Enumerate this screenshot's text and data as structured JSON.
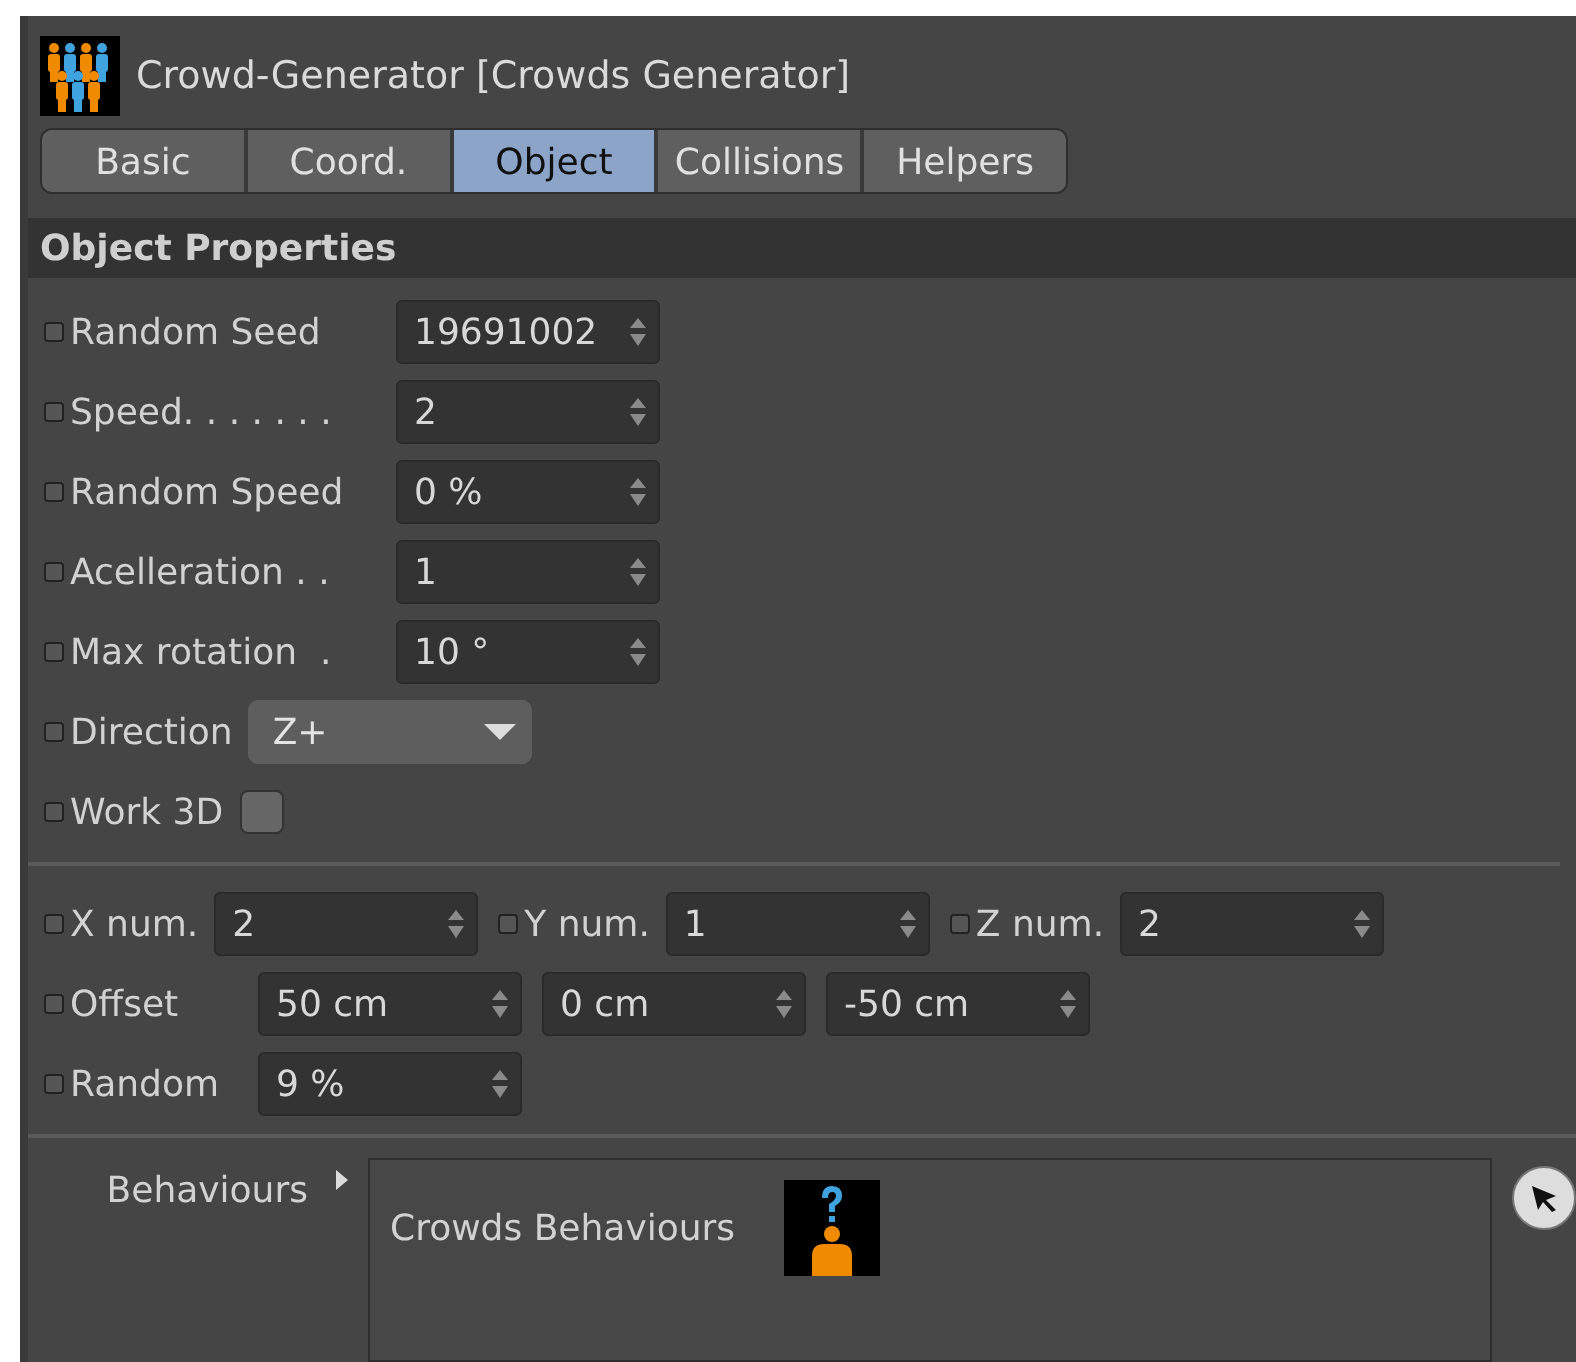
{
  "window": {
    "title": "Crowd-Generator [Crowds Generator]"
  },
  "tabs": [
    {
      "label": "Basic",
      "selected": false
    },
    {
      "label": "Coord.",
      "selected": false
    },
    {
      "label": "Object",
      "selected": true
    },
    {
      "label": "Collisions",
      "selected": false
    },
    {
      "label": "Helpers",
      "selected": false
    }
  ],
  "section": {
    "title": "Object Properties"
  },
  "properties": [
    {
      "kind": "number",
      "label": "Random Seed",
      "value": "19691002"
    },
    {
      "kind": "number",
      "label": "Speed. . . . . . .",
      "value": "2"
    },
    {
      "kind": "number",
      "label": "Random Speed",
      "value": "0 %"
    },
    {
      "kind": "number",
      "label": "Acelleration . .",
      "value": "1"
    },
    {
      "kind": "number",
      "label": "Max rotation  .",
      "value": "10 °"
    },
    {
      "kind": "dropdown",
      "label": "Direction",
      "value": "Z+"
    },
    {
      "kind": "checkbox",
      "label": "Work 3D",
      "checked": false
    }
  ],
  "lines": [
    {
      "cells": [
        {
          "label": "X num.",
          "values": [
            "2"
          ]
        },
        {
          "label": "Y num.",
          "values": [
            "1"
          ]
        },
        {
          "label": "Z num.",
          "values": [
            "2"
          ]
        }
      ]
    },
    {
      "cells": [
        {
          "label": "Offset",
          "values": [
            "50 cm",
            "0 cm",
            "-50 cm"
          ]
        }
      ]
    },
    {
      "cells": [
        {
          "label": "Random",
          "values": [
            "9 %"
          ]
        }
      ]
    }
  ],
  "behaviours": {
    "label": "Behaviours",
    "items": [
      "Crowds Behaviours"
    ]
  }
}
